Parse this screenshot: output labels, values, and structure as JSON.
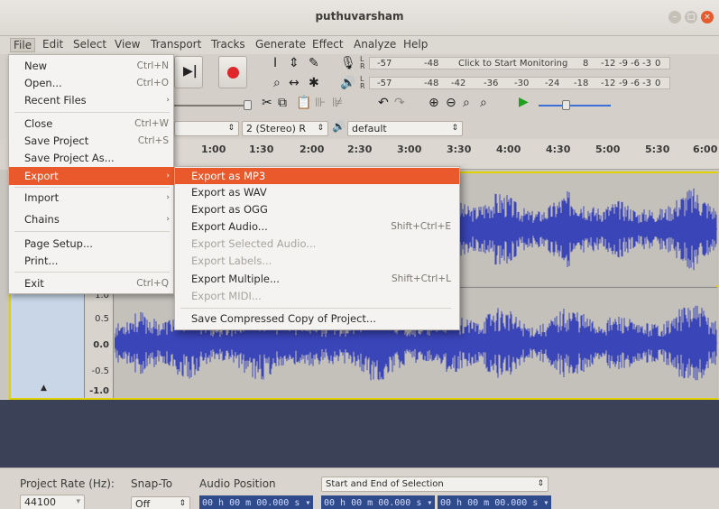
{
  "window": {
    "title": "puthuvarsham"
  },
  "menubar": [
    "File",
    "Edit",
    "Select",
    "View",
    "Transport",
    "Tracks",
    "Generate",
    "Effect",
    "Analyze",
    "Help"
  ],
  "meters": {
    "record": {
      "values": [
        "-57",
        "-48",
        "-12",
        "-9",
        "-6",
        "-3",
        "0"
      ],
      "prompt": "Click to Start Monitoring",
      "mid": "8"
    },
    "play": {
      "values": [
        "-57",
        "-48",
        "-42",
        "-36",
        "-30",
        "-24",
        "-18",
        "-12",
        "-9",
        "-6",
        "-3",
        "0"
      ]
    }
  },
  "device": {
    "channels": "2 (Stereo) R",
    "output": "default"
  },
  "ruler": [
    "1:00",
    "1:30",
    "2:00",
    "2:30",
    "3:00",
    "3:30",
    "4:00",
    "4:30",
    "5:00",
    "5:30",
    "6:00"
  ],
  "vruler": [
    "1.0",
    "0.5",
    "0.0",
    "-0.5",
    "-1.0"
  ],
  "file_menu": [
    {
      "label": "New",
      "shortcut": "Ctrl+N"
    },
    {
      "label": "Open...",
      "shortcut": "Ctrl+O"
    },
    {
      "label": "Recent Files",
      "shortcut": "",
      "submenu": true
    },
    {
      "label": "Close",
      "shortcut": "Ctrl+W"
    },
    {
      "label": "Save Project",
      "shortcut": "Ctrl+S"
    },
    {
      "label": "Save Project As...",
      "shortcut": ""
    },
    {
      "label": "Export",
      "shortcut": "",
      "submenu": true,
      "highlighted": true
    },
    {
      "label": "Import",
      "shortcut": "",
      "submenu": true
    },
    {
      "label": "Chains",
      "shortcut": "",
      "submenu": true
    },
    {
      "label": "Page Setup...",
      "shortcut": ""
    },
    {
      "label": "Print...",
      "shortcut": ""
    },
    {
      "label": "Exit",
      "shortcut": "Ctrl+Q"
    }
  ],
  "export_menu": [
    {
      "label": "Export as MP3",
      "shortcut": "",
      "highlighted": true
    },
    {
      "label": "Export as WAV",
      "shortcut": ""
    },
    {
      "label": "Export as OGG",
      "shortcut": ""
    },
    {
      "label": "Export Audio...",
      "shortcut": "Shift+Ctrl+E"
    },
    {
      "label": "Export Selected Audio...",
      "shortcut": "",
      "disabled": true
    },
    {
      "label": "Export Labels...",
      "shortcut": "",
      "disabled": true
    },
    {
      "label": "Export Multiple...",
      "shortcut": "Shift+Ctrl+L"
    },
    {
      "label": "Export MIDI...",
      "shortcut": "",
      "disabled": true
    },
    {
      "label": "Save Compressed Copy of Project...",
      "shortcut": ""
    }
  ],
  "selection_bar": {
    "project_rate_label": "Project Rate (Hz):",
    "project_rate": "44100",
    "snap_label": "Snap-To",
    "snap_value": "Off",
    "audio_position_label": "Audio Position",
    "selection_mode": "Start and End of Selection",
    "audio_position": "00 h 00 m 00.000 s",
    "sel_start": "00 h 00 m 00.000 s",
    "sel_end": "00 h 00 m 00.000 s"
  },
  "colors": {
    "accent": "#e9592b",
    "wave": "#3a45b8",
    "track_border": "#e0d200",
    "empty_area": "#3b4257"
  }
}
